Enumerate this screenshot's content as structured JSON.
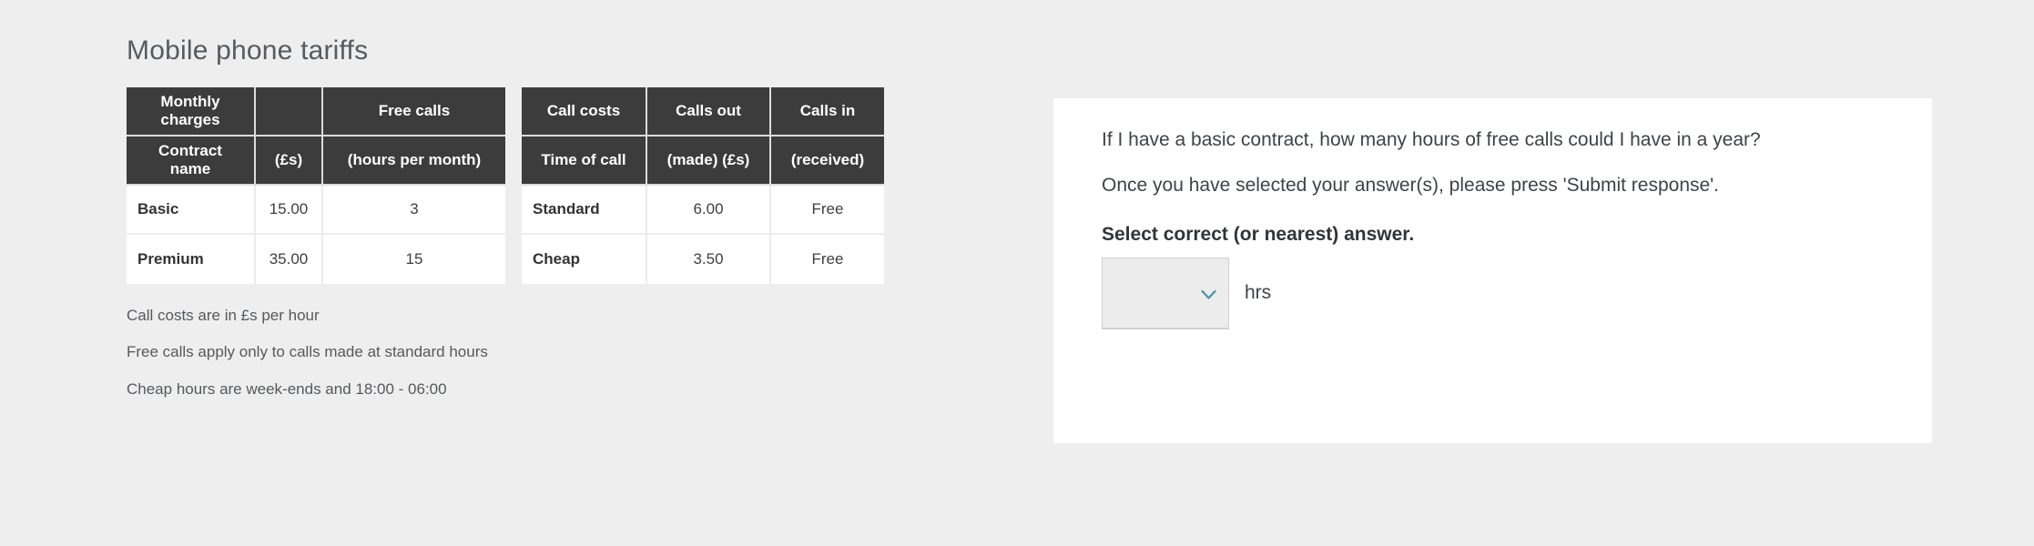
{
  "page": {
    "title": "Mobile phone tariffs",
    "background_color": "#eeeeee"
  },
  "tables": [
    {
      "name": "monthly-charges",
      "header_top": [
        "Monthly charges",
        "",
        "Free calls"
      ],
      "header_sub": [
        "Contract name",
        "(£s)",
        "(hours per month)"
      ],
      "rows": [
        [
          "Basic",
          "15.00",
          "3"
        ],
        [
          "Premium",
          "35.00",
          "15"
        ]
      ]
    },
    {
      "name": "call-costs",
      "header_top": [
        "Call costs",
        "Calls out",
        "Calls in"
      ],
      "header_sub": [
        "Time of call",
        "(made) (£s)",
        "(received)"
      ],
      "rows": [
        [
          "Standard",
          "6.00",
          "Free"
        ],
        [
          "Cheap",
          "3.50",
          "Free"
        ]
      ]
    }
  ],
  "notes": [
    "Call costs are in £s per hour",
    "Free calls apply only to calls made at standard hours",
    "Cheap hours are week-ends and 18:00 - 06:00"
  ],
  "question": {
    "text": "If I have a basic contract, how many hours of free calls could I have in a year?",
    "instruction": "Once you have selected your answer(s), please press 'Submit response'.",
    "prompt": "Select correct (or nearest) answer.",
    "answer": {
      "selected_value": "",
      "unit_label": "hrs",
      "chevron_icon": "chevron-down-icon",
      "chevron_color": "#4a91a8"
    }
  },
  "colors": {
    "header_cell": "#3c3c3c",
    "panel": "#ffffff",
    "text": "#3f4346"
  }
}
